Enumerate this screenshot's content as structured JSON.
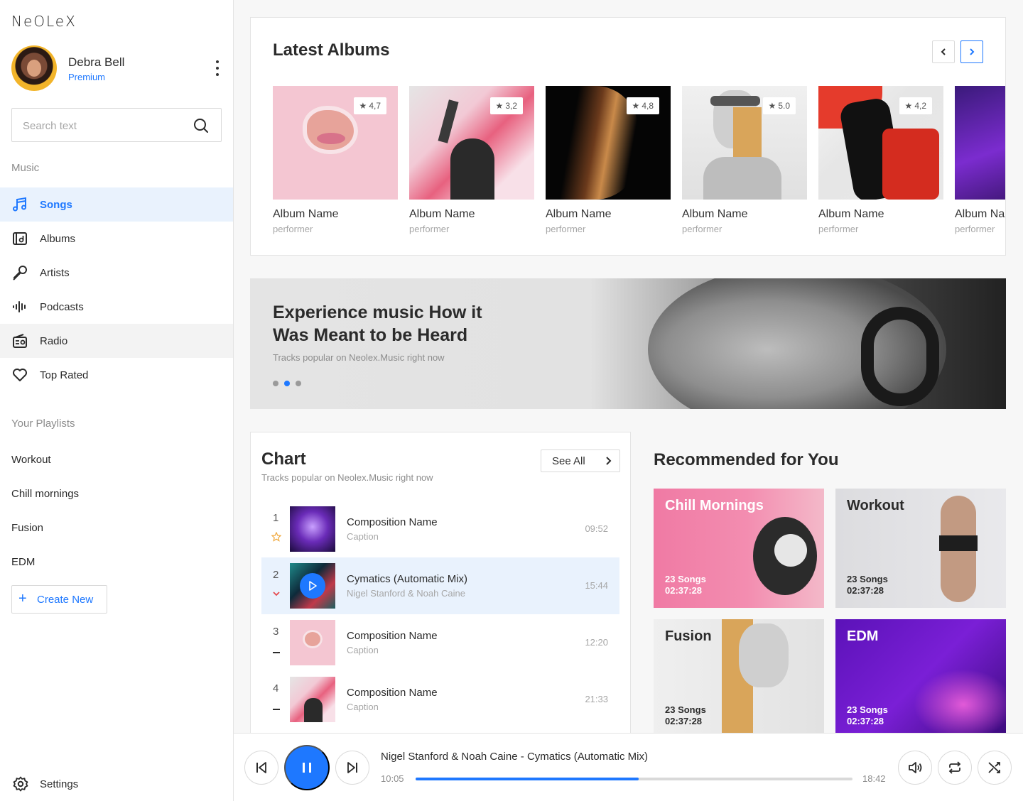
{
  "brand": {
    "logo": "NeOLeX"
  },
  "profile": {
    "name": "Debra Bell",
    "plan": "Premium"
  },
  "search": {
    "placeholder": "Search text"
  },
  "sidebar": {
    "music_label": "Music",
    "nav": [
      {
        "label": "Songs",
        "icon": "music-note-icon"
      },
      {
        "label": "Albums",
        "icon": "album-icon"
      },
      {
        "label": "Artists",
        "icon": "microphone-icon"
      },
      {
        "label": "Podcasts",
        "icon": "soundwave-icon"
      },
      {
        "label": "Radio",
        "icon": "radio-icon"
      },
      {
        "label": "Top Rated",
        "icon": "heart-icon"
      }
    ],
    "playlists_label": "Your Playlists",
    "playlists": [
      "Workout",
      "Chill mornings",
      "Fusion",
      "EDM"
    ],
    "create_new": "Create New",
    "settings": "Settings"
  },
  "albums": {
    "title": "Latest Albums",
    "items": [
      {
        "name": "Album Name",
        "performer": "performer",
        "rating": "4,7"
      },
      {
        "name": "Album Name",
        "performer": "performer",
        "rating": "3,2"
      },
      {
        "name": "Album Name",
        "performer": "performer",
        "rating": "4,8"
      },
      {
        "name": "Album Name",
        "performer": "performer",
        "rating": "5.0"
      },
      {
        "name": "Album Name",
        "performer": "performer",
        "rating": "4,2"
      },
      {
        "name": "Album Name",
        "performer": "performer",
        "rating": ""
      }
    ]
  },
  "hero": {
    "title": "Experience music How it Was Meant to be Heard",
    "subtitle": "Tracks popular on Neolex.Music right now",
    "active_slide": 1
  },
  "chart": {
    "title": "Chart",
    "subtitle": "Tracks popular on Neolex.Music right now",
    "see_all": "See All",
    "tracks": [
      {
        "num": "1",
        "name": "Composition Name",
        "caption": "Caption",
        "duration": "09:52",
        "trend": "new"
      },
      {
        "num": "2",
        "name": "Cymatics (Automatic Mix)",
        "caption": "Nigel Stanford & Noah Caine",
        "duration": "15:44",
        "trend": "down"
      },
      {
        "num": "3",
        "name": "Composition Name",
        "caption": "Caption",
        "duration": "12:20",
        "trend": "same"
      },
      {
        "num": "4",
        "name": "Composition Name",
        "caption": "Caption",
        "duration": "21:33",
        "trend": "same"
      }
    ]
  },
  "recommended": {
    "title": "Recommended for You",
    "items": [
      {
        "title": "Chill Mornings",
        "songs": "23 Songs",
        "duration": "02:37:28"
      },
      {
        "title": "Workout",
        "songs": "23 Songs",
        "duration": "02:37:28"
      },
      {
        "title": "Fusion",
        "songs": "23 Songs",
        "duration": "02:37:28"
      },
      {
        "title": "EDM",
        "songs": "23 Songs",
        "duration": "02:37:28"
      }
    ]
  },
  "player": {
    "now_playing": "Nigel Stanford & Noah Caine - Cymatics (Automatic Mix)",
    "elapsed": "10:05",
    "total": "18:42",
    "progress": 0.51
  },
  "colors": {
    "accent": "#1e78ff",
    "trend_down": "#e5484d",
    "star": "#f0a83c"
  }
}
